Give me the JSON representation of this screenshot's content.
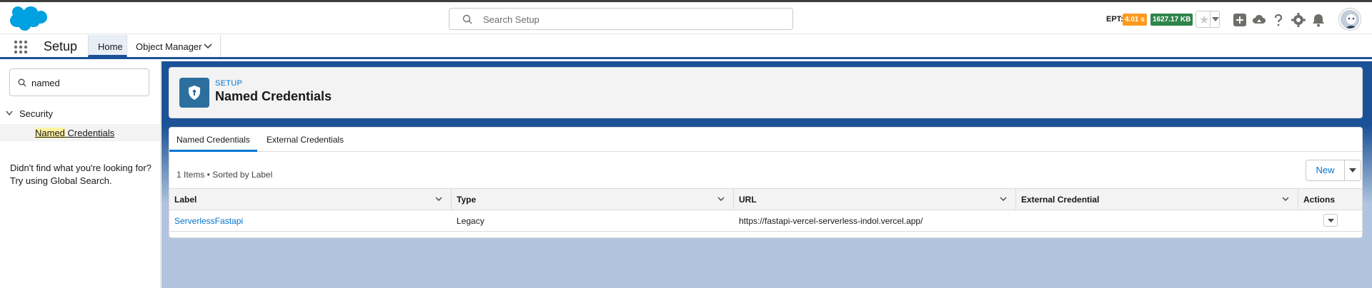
{
  "header": {
    "search_placeholder": "Search Setup",
    "ept_label": "EPT:",
    "ept_value": "4.01 s",
    "kb_value": "1627.17 KB",
    "icons": [
      "salesforce-cloud-logo",
      "search-icon",
      "star-icon",
      "chevron-down-icon",
      "add-icon",
      "trailhead-icon",
      "help-icon",
      "gear-icon",
      "bell-icon",
      "avatar"
    ]
  },
  "context_nav": {
    "app_name": "Setup",
    "tabs": [
      {
        "label": "Home",
        "active": true
      },
      {
        "label": "Object Manager",
        "active": false
      }
    ]
  },
  "sidebar": {
    "quickfind_value": "named",
    "section": "Security",
    "item_highlight": "Named",
    "item_rest": " Credentials",
    "help_line1": "Didn't find what you're looking for?",
    "help_line2": "Try using Global Search."
  },
  "page_header": {
    "eyebrow": "SETUP",
    "title": "Named Credentials"
  },
  "card": {
    "tabs": [
      {
        "label": "Named Credentials",
        "active": true
      },
      {
        "label": "External Credentials",
        "active": false
      }
    ],
    "item_count": "1 Items • Sorted by Label",
    "new_button": "New",
    "columns": [
      "Label",
      "Type",
      "URL",
      "External Credential",
      "Actions"
    ],
    "rows": [
      {
        "label": "ServerlessFastapi",
        "type": "Legacy",
        "url": "https://fastapi-vercel-serverless-indol.vercel.app/",
        "external_credential": ""
      }
    ]
  },
  "colors": {
    "brand_blue": "#1b5297",
    "link_blue": "#0176d3",
    "ept_orange": "#ff9a1f",
    "kb_green": "#2e844a"
  }
}
